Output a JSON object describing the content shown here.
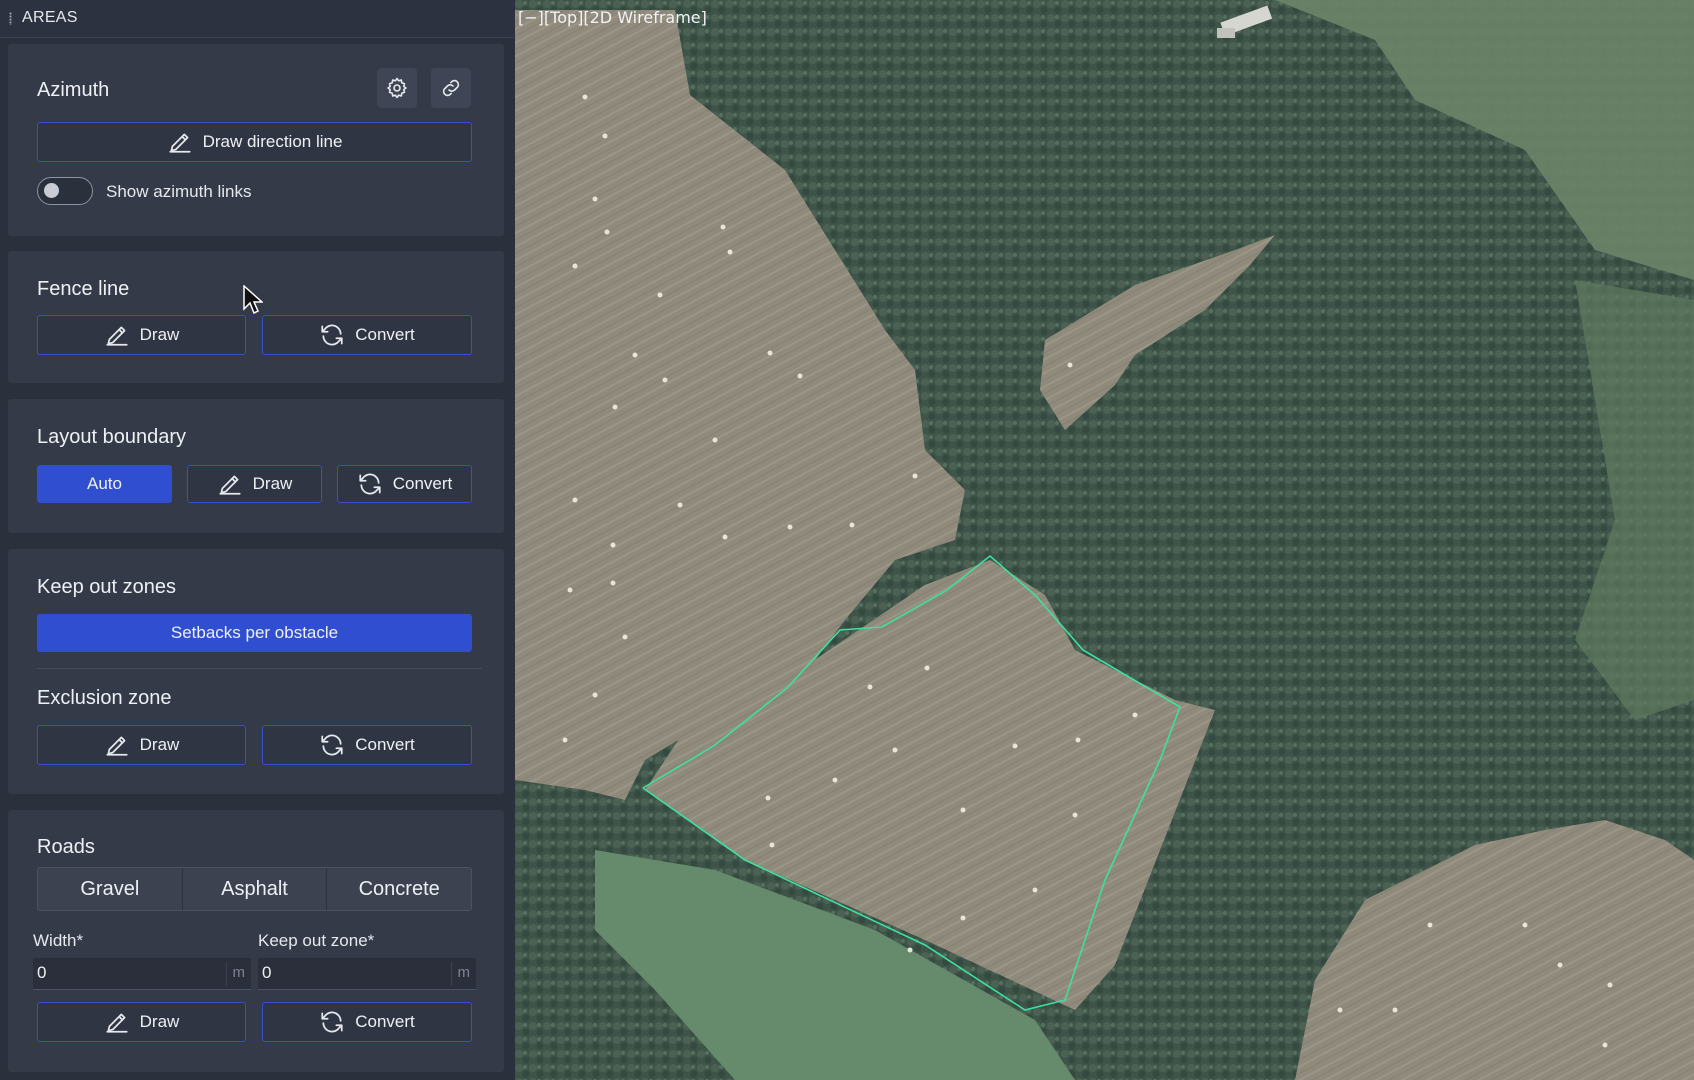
{
  "panel": {
    "title": "AREAS"
  },
  "azimuth": {
    "heading": "Azimuth",
    "draw_direction_label": "Draw direction line",
    "toggle_label": "Show azimuth links",
    "toggle_on": false
  },
  "fence_line": {
    "heading": "Fence line",
    "draw_label": "Draw",
    "convert_label": "Convert"
  },
  "layout_boundary": {
    "heading": "Layout boundary",
    "auto_label": "Auto",
    "draw_label": "Draw",
    "convert_label": "Convert"
  },
  "keep_out": {
    "heading": "Keep out zones",
    "setbacks_label": "Setbacks per obstacle"
  },
  "exclusion": {
    "heading": "Exclusion zone",
    "draw_label": "Draw",
    "convert_label": "Convert"
  },
  "roads": {
    "heading": "Roads",
    "types": [
      "Gravel",
      "Asphalt",
      "Concrete"
    ],
    "width_label": "Width*",
    "width_value": "0",
    "keepout_label": "Keep out zone*",
    "keepout_value": "0",
    "unit": "m",
    "draw_label": "Draw",
    "convert_label": "Convert"
  },
  "viewport": {
    "label": "[−][Top][2D Wireframe]"
  },
  "colors": {
    "accent": "#2f4fd0",
    "boundary": "#3ee0a0",
    "panel": "#2b303d",
    "card": "#343a48"
  }
}
